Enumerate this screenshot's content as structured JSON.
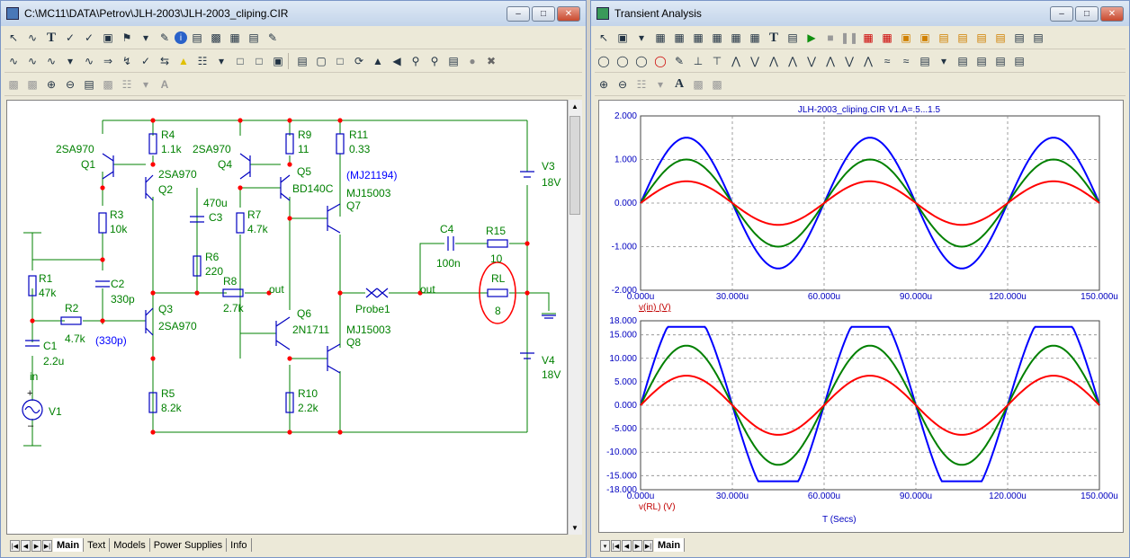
{
  "schematic_window": {
    "title": "C:\\MC11\\DATA\\Petrov\\JLH-2003\\JLH-2003_cliping.CIR",
    "tabs": [
      "Main",
      "Text",
      "Models",
      "Power Supplies",
      "Info"
    ],
    "labels": {
      "q1_model": "2SA970",
      "q1": "Q1",
      "r4": "R4",
      "r4v": "1.1k",
      "q2_model": "2SA970",
      "q2": "Q2",
      "q4_model": "2SA970",
      "q4": "Q4",
      "r9": "R9",
      "r9v": "11",
      "q5": "Q5",
      "q5_model": "BD140C",
      "r11": "R11",
      "r11v": "0.33",
      "mj_alt": "(MJ21194)",
      "q7_model": "MJ15003",
      "q7": "Q7",
      "v3": "V3",
      "v3v": "18V",
      "r3": "R3",
      "r3v": "10k",
      "c3v": "470u",
      "c3": "C3",
      "r7": "R7",
      "r7v": "4.7k",
      "c4": "C4",
      "c4v": "100n",
      "r15": "R15",
      "r15v": "10",
      "r1": "R1",
      "r1v": "47k",
      "c2": "C2",
      "c2v": "330p",
      "r6": "R6",
      "r6v": "220",
      "r8": "R8",
      "r8v": "2.7k",
      "out1": "out",
      "out2": "out",
      "probe": "Probe1",
      "rl": "RL",
      "rlv": "8",
      "r2": "R2",
      "r2v": "4.7k",
      "c2_alt": "(330p)",
      "q3": "Q3",
      "q3_model": "2SA970",
      "q6": "Q6",
      "q6_model": "2N1711",
      "q8_model": "MJ15003",
      "q8": "Q8",
      "c1": "C1",
      "c1v": "2.2u",
      "in": "in",
      "v4": "V4",
      "v4v": "18V",
      "v1": "V1",
      "r5": "R5",
      "r5v": "8.2k",
      "r10": "R10",
      "r10v": "2.2k"
    }
  },
  "analysis_window": {
    "title": "Transient Analysis",
    "tabs": [
      "Main"
    ],
    "plot_title": "JLH-2003_cliping.CIR V1.A=.5...1.5",
    "xlabel": "T (Secs)",
    "top_trace_label": "v(in) (V)",
    "bottom_trace_label": "v(RL) (V)",
    "x_ticks": [
      "0.000u",
      "30.000u",
      "60.000u",
      "90.000u",
      "120.000u",
      "150.000u"
    ],
    "top_y_ticks": [
      "2.000",
      "1.000",
      "0.000",
      "-1.000",
      "-2.000"
    ],
    "bottom_y_ticks": [
      "18.000",
      "15.000",
      "10.000",
      "5.000",
      "0.000",
      "-5.000",
      "-10.000",
      "-15.000",
      "-18.000"
    ]
  },
  "chart_data": [
    {
      "type": "line",
      "title": "JLH-2003_cliping.CIR V1.A=.5...1.5",
      "xlabel": "",
      "ylabel": "v(in) (V)",
      "xlim": [
        0,
        150
      ],
      "ylim": [
        -2,
        2
      ],
      "x_unit": "u",
      "grid": true,
      "series": [
        {
          "amplitude": 1.5,
          "color": "#0000ff"
        },
        {
          "amplitude": 1.0,
          "color": "#008000"
        },
        {
          "amplitude": 0.5,
          "color": "#ff0000"
        }
      ],
      "period": 60
    },
    {
      "type": "line",
      "title": "",
      "xlabel": "T (Secs)",
      "ylabel": "v(RL) (V)",
      "xlim": [
        0,
        150
      ],
      "ylim": [
        -18,
        18
      ],
      "grid": true,
      "series": [
        {
          "amplitude": 21.0,
          "clip_high": 16.7,
          "clip_low": -16.2,
          "color": "#0000ff"
        },
        {
          "amplitude": 12.7,
          "color": "#008000"
        },
        {
          "amplitude": 6.3,
          "color": "#ff0000"
        }
      ],
      "period": 60
    }
  ],
  "colors": {
    "wire": "#008000",
    "node": "#ff0000",
    "component": "#0000c0",
    "text": "#008000",
    "model_alt": "#0000ff"
  }
}
